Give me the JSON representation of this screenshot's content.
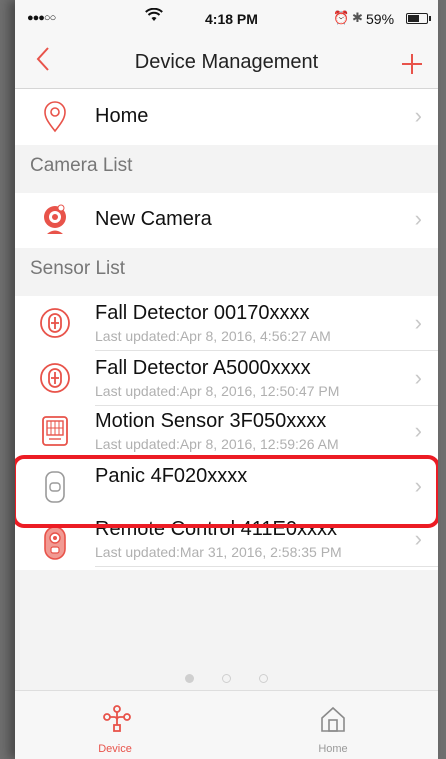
{
  "status_bar": {
    "signal": "●●●○○",
    "time": "4:18 PM",
    "battery": "59%"
  },
  "navbar": {
    "back_icon": "chevron-left-icon",
    "title": "Device Management",
    "add_icon": "plus-icon"
  },
  "home_row": {
    "label": "Home",
    "icon": "location-pin-icon"
  },
  "sections": {
    "camera": "Camera List",
    "sensor": "Sensor List"
  },
  "camera_rows": [
    {
      "label": "New Camera",
      "icon": "camera-icon"
    }
  ],
  "sensor_rows": [
    {
      "name": "Fall Detector 00170xxxx",
      "updated": "Last updated:Apr 8, 2016, 4:56:27 AM",
      "icon": "fall-detector-icon"
    },
    {
      "name": "Fall Detector A5000xxxx",
      "updated": "Last updated:Apr 8, 2016, 12:50:47 PM",
      "icon": "fall-detector-icon"
    },
    {
      "name": "Motion Sensor 3F050xxxx",
      "updated": "Last updated:Apr 8, 2016, 12:59:26 AM",
      "icon": "motion-sensor-icon"
    },
    {
      "name": "Panic 4F020xxxx",
      "updated": "",
      "icon": "panic-button-icon"
    },
    {
      "name": "Remote Control 411E0xxxx",
      "updated": "Last updated:Mar 31, 2016, 2:58:35 PM",
      "icon": "remote-control-icon"
    }
  ],
  "page_dots": {
    "count": 3,
    "active": 0
  },
  "tabs": [
    {
      "label": "Device",
      "icon": "device-network-icon",
      "active": true
    },
    {
      "label": "Home",
      "icon": "home-icon",
      "active": false
    }
  ],
  "colors": {
    "accent": "#e8534a",
    "highlight": "#ec1c24",
    "inactive": "#9a9a9a"
  }
}
